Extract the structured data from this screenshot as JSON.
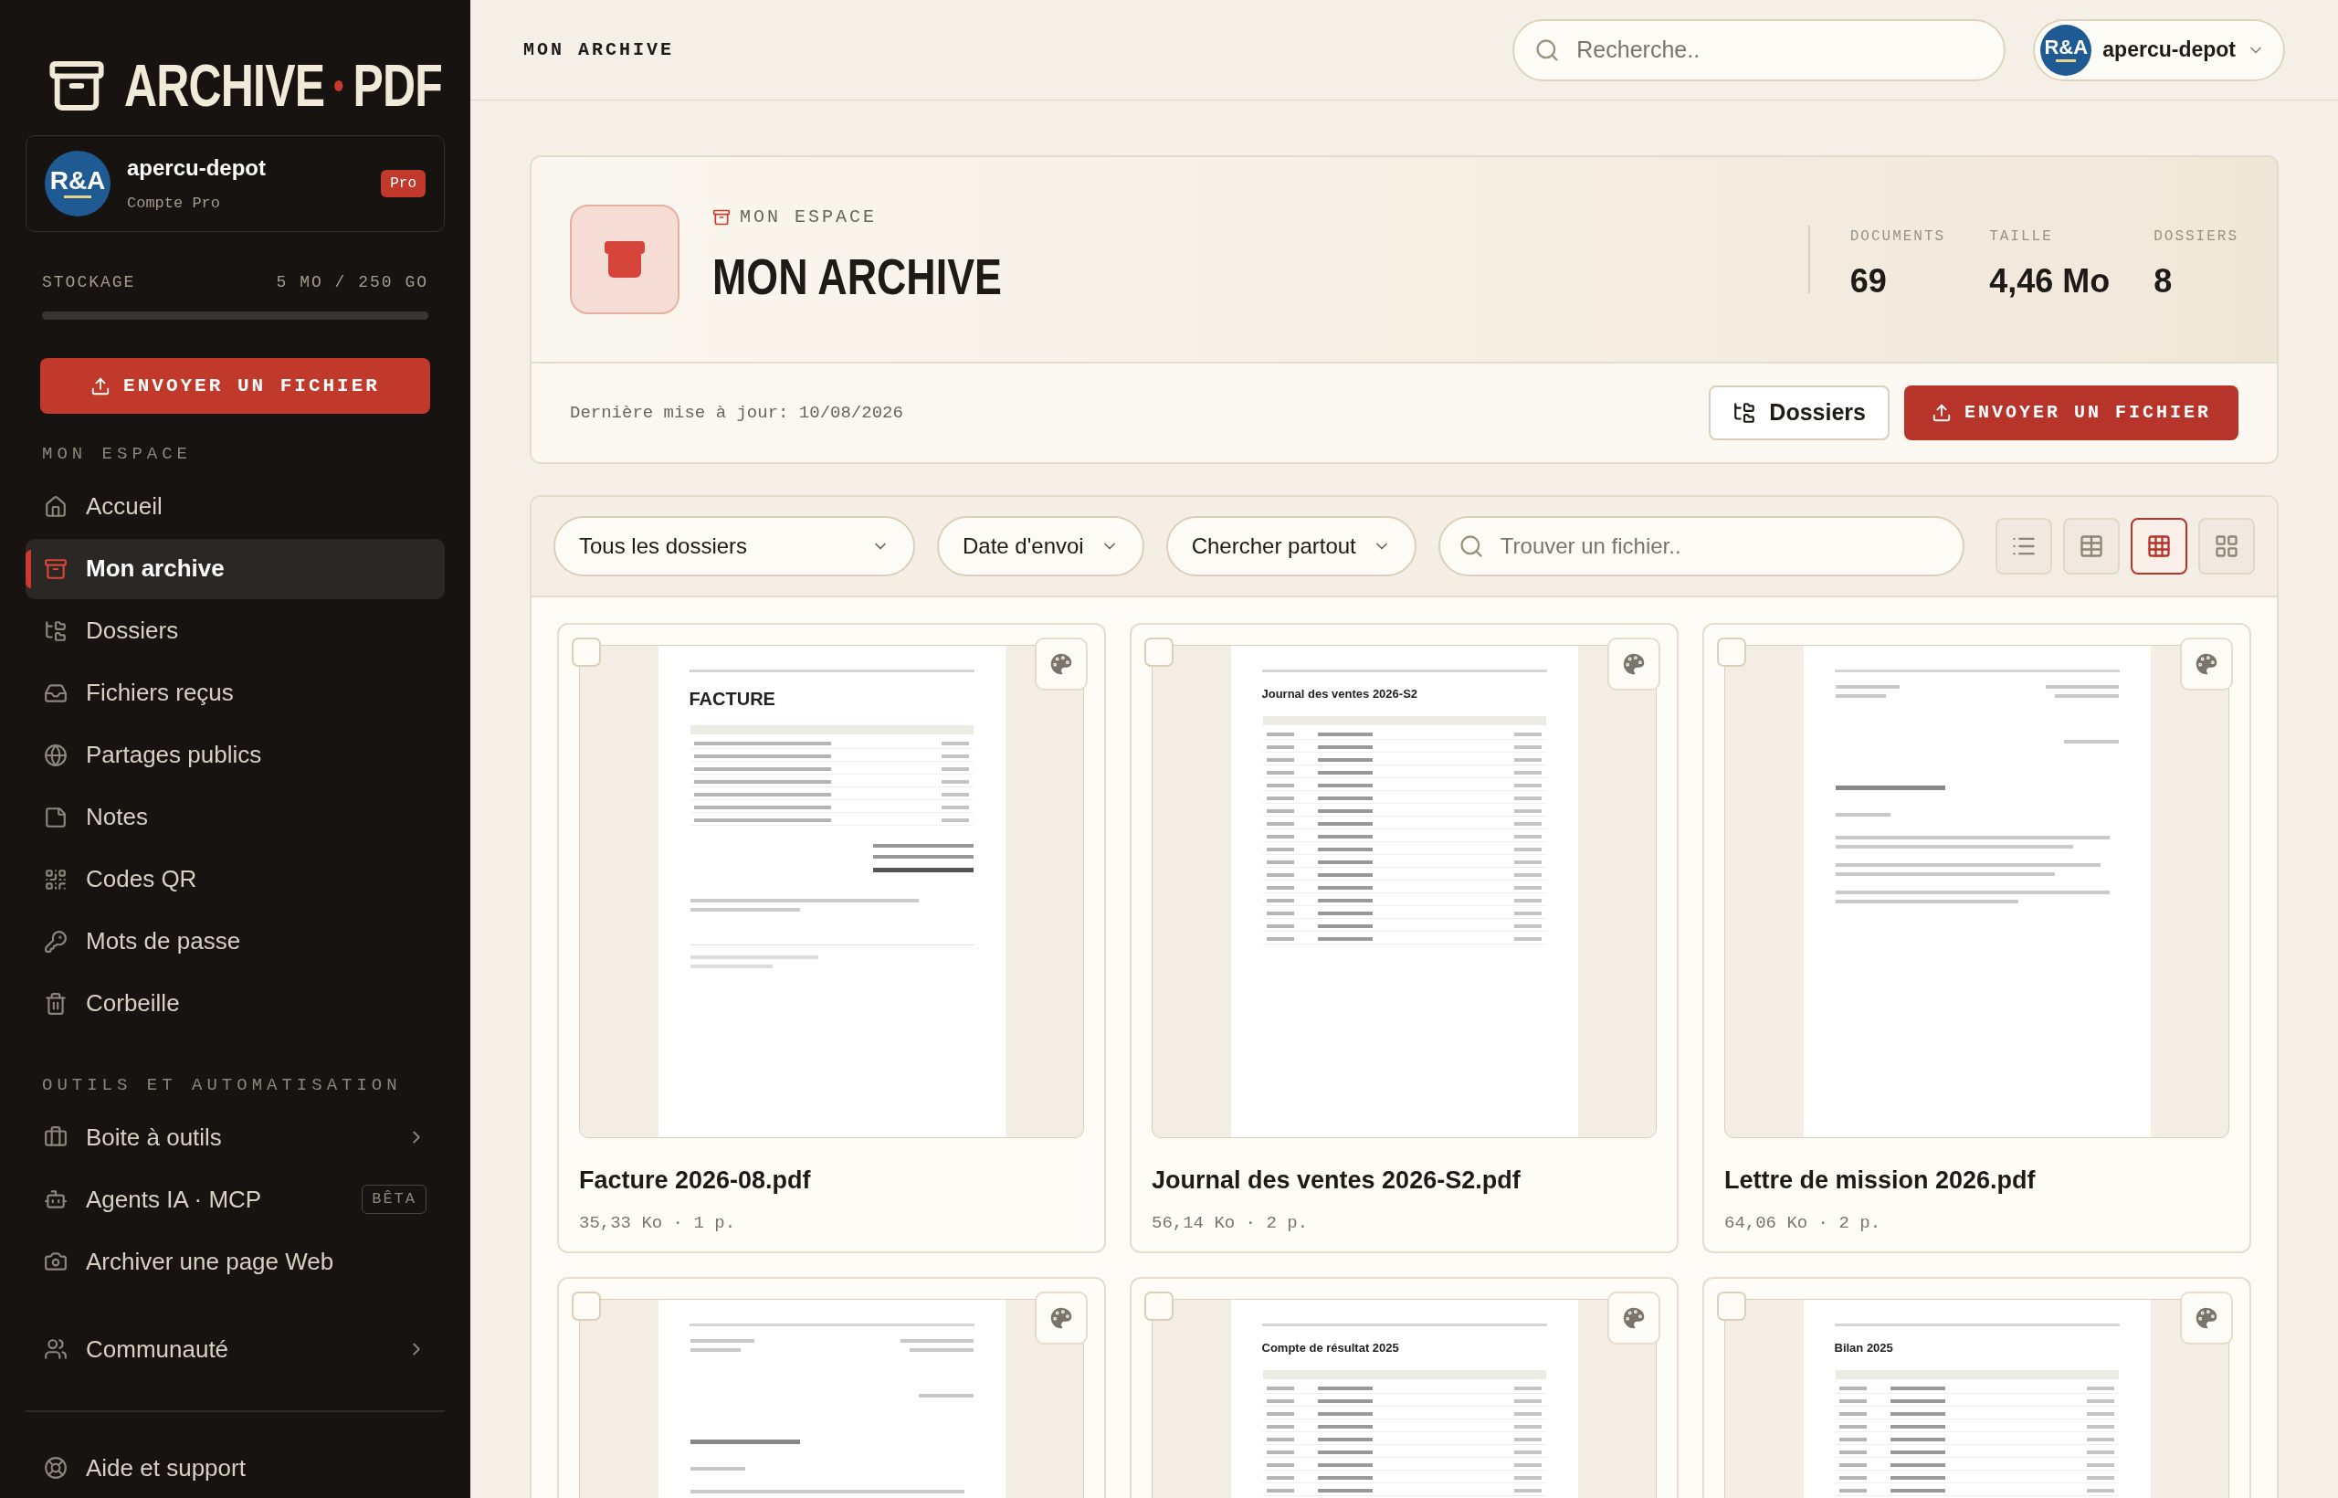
{
  "brand": {
    "parts": [
      "ARCHIVE",
      "PDF"
    ]
  },
  "account": {
    "avatar": "R&A",
    "name": "apercu-depot",
    "plan": "Compte Pro",
    "badge": "Pro"
  },
  "storage": {
    "label": "STOCKAGE",
    "reading": "5 MO / 250 GO",
    "level": 0.0
  },
  "upload_button": "ENVOYER UN FICHIER",
  "sections": [
    {
      "title": "MON ESPACE",
      "items": [
        {
          "label": "Accueil",
          "kind": "home",
          "selected": false
        },
        {
          "label": "Mon archive",
          "kind": "archive",
          "selected": true
        },
        {
          "label": "Dossiers",
          "kind": "folders",
          "selected": false
        },
        {
          "label": "Fichiers reçus",
          "kind": "inbox",
          "selected": false
        },
        {
          "label": "Partages publics",
          "kind": "globe",
          "selected": false
        },
        {
          "label": "Notes",
          "kind": "note",
          "selected": false
        },
        {
          "label": "Codes QR",
          "kind": "qr",
          "selected": false
        },
        {
          "label": "Mots de passe",
          "kind": "key",
          "selected": false
        },
        {
          "label": "Corbeille",
          "kind": "trash",
          "selected": false
        }
      ]
    },
    {
      "title": "OUTILS ET AUTOMATISATION",
      "items": [
        {
          "label": "Boite à outils",
          "kind": "toolbox",
          "selected": false,
          "expandable": true
        },
        {
          "label": "Agents IA · MCP",
          "kind": "bot",
          "selected": false,
          "badge": "BÊTA"
        },
        {
          "label": "Archiver une page Web",
          "kind": "camera",
          "selected": false
        }
      ]
    }
  ],
  "community": {
    "label": "Communauté",
    "kind": "users",
    "selected": false,
    "expandable": true
  },
  "help": {
    "label": "Aide et support",
    "kind": "lifebuoy",
    "selected": false
  },
  "header": {
    "breadcrumb": "MON ARCHIVE",
    "search_placeholder": "Recherche..",
    "user": {
      "avatar": "R&A",
      "name": "apercu-depot"
    }
  },
  "hero": {
    "eyebrow": "MON ESPACE",
    "title": "MON ARCHIVE",
    "stats": [
      {
        "label": "DOCUMENTS",
        "value": "69"
      },
      {
        "label": "TAILLE",
        "value": "4,46 Mo"
      },
      {
        "label": "DOSSIERS",
        "value": "8"
      }
    ],
    "updated": "Dernière mise à jour: 10/08/2026",
    "folders_button": "Dossiers",
    "upload_button": "ENVOYER UN FICHIER"
  },
  "toolbar": {
    "filters": [
      {
        "label": "Tous les dossiers"
      },
      {
        "label": "Date d'envoi"
      },
      {
        "label": "Chercher partout"
      }
    ],
    "search_placeholder": "Trouver un fichier..",
    "views": [
      {
        "kind": "list",
        "selected": false
      },
      {
        "kind": "table",
        "selected": false
      },
      {
        "kind": "grid",
        "selected": true
      },
      {
        "kind": "large",
        "selected": false
      }
    ]
  },
  "files": [
    {
      "name": "Facture 2026-08.pdf",
      "meta": "35,33 Ko · 1 p.",
      "kind": "invoice",
      "preview_title": "FACTURE",
      "checked": false
    },
    {
      "name": "Journal des ventes 2026-S2.pdf",
      "meta": "56,14 Ko · 2 p.",
      "kind": "ledger",
      "preview_title": "Journal des ventes 2026-S2",
      "checked": false
    },
    {
      "name": "Lettre de mission 2026.pdf",
      "meta": "64,06 Ko · 2 p.",
      "kind": "letter",
      "checked": false
    },
    {
      "kind": "letter",
      "checked": false
    },
    {
      "kind": "ledger",
      "preview_title": "Compte de résultat 2025",
      "checked": false
    },
    {
      "kind": "ledger",
      "preview_title": "Bilan 2025",
      "checked": false
    }
  ]
}
